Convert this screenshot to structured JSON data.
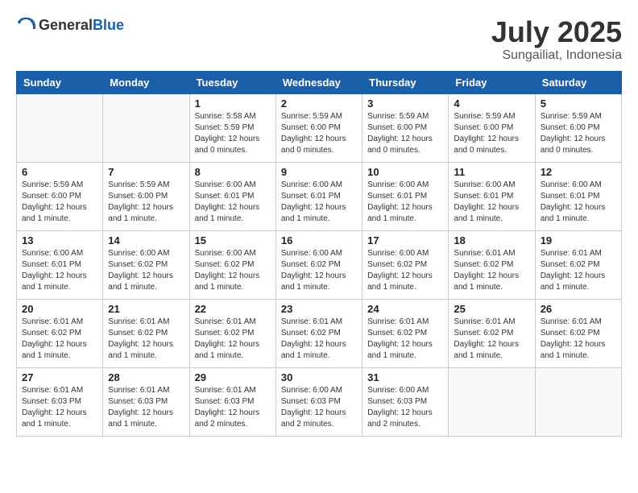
{
  "header": {
    "logo_general": "General",
    "logo_blue": "Blue",
    "month": "July 2025",
    "location": "Sungailiat, Indonesia"
  },
  "weekdays": [
    "Sunday",
    "Monday",
    "Tuesday",
    "Wednesday",
    "Thursday",
    "Friday",
    "Saturday"
  ],
  "weeks": [
    [
      {
        "day": "",
        "info": ""
      },
      {
        "day": "",
        "info": ""
      },
      {
        "day": "1",
        "info": "Sunrise: 5:58 AM\nSunset: 5:59 PM\nDaylight: 12 hours and 0 minutes."
      },
      {
        "day": "2",
        "info": "Sunrise: 5:59 AM\nSunset: 6:00 PM\nDaylight: 12 hours and 0 minutes."
      },
      {
        "day": "3",
        "info": "Sunrise: 5:59 AM\nSunset: 6:00 PM\nDaylight: 12 hours and 0 minutes."
      },
      {
        "day": "4",
        "info": "Sunrise: 5:59 AM\nSunset: 6:00 PM\nDaylight: 12 hours and 0 minutes."
      },
      {
        "day": "5",
        "info": "Sunrise: 5:59 AM\nSunset: 6:00 PM\nDaylight: 12 hours and 0 minutes."
      }
    ],
    [
      {
        "day": "6",
        "info": "Sunrise: 5:59 AM\nSunset: 6:00 PM\nDaylight: 12 hours and 1 minute."
      },
      {
        "day": "7",
        "info": "Sunrise: 5:59 AM\nSunset: 6:00 PM\nDaylight: 12 hours and 1 minute."
      },
      {
        "day": "8",
        "info": "Sunrise: 6:00 AM\nSunset: 6:01 PM\nDaylight: 12 hours and 1 minute."
      },
      {
        "day": "9",
        "info": "Sunrise: 6:00 AM\nSunset: 6:01 PM\nDaylight: 12 hours and 1 minute."
      },
      {
        "day": "10",
        "info": "Sunrise: 6:00 AM\nSunset: 6:01 PM\nDaylight: 12 hours and 1 minute."
      },
      {
        "day": "11",
        "info": "Sunrise: 6:00 AM\nSunset: 6:01 PM\nDaylight: 12 hours and 1 minute."
      },
      {
        "day": "12",
        "info": "Sunrise: 6:00 AM\nSunset: 6:01 PM\nDaylight: 12 hours and 1 minute."
      }
    ],
    [
      {
        "day": "13",
        "info": "Sunrise: 6:00 AM\nSunset: 6:01 PM\nDaylight: 12 hours and 1 minute."
      },
      {
        "day": "14",
        "info": "Sunrise: 6:00 AM\nSunset: 6:02 PM\nDaylight: 12 hours and 1 minute."
      },
      {
        "day": "15",
        "info": "Sunrise: 6:00 AM\nSunset: 6:02 PM\nDaylight: 12 hours and 1 minute."
      },
      {
        "day": "16",
        "info": "Sunrise: 6:00 AM\nSunset: 6:02 PM\nDaylight: 12 hours and 1 minute."
      },
      {
        "day": "17",
        "info": "Sunrise: 6:00 AM\nSunset: 6:02 PM\nDaylight: 12 hours and 1 minute."
      },
      {
        "day": "18",
        "info": "Sunrise: 6:01 AM\nSunset: 6:02 PM\nDaylight: 12 hours and 1 minute."
      },
      {
        "day": "19",
        "info": "Sunrise: 6:01 AM\nSunset: 6:02 PM\nDaylight: 12 hours and 1 minute."
      }
    ],
    [
      {
        "day": "20",
        "info": "Sunrise: 6:01 AM\nSunset: 6:02 PM\nDaylight: 12 hours and 1 minute."
      },
      {
        "day": "21",
        "info": "Sunrise: 6:01 AM\nSunset: 6:02 PM\nDaylight: 12 hours and 1 minute."
      },
      {
        "day": "22",
        "info": "Sunrise: 6:01 AM\nSunset: 6:02 PM\nDaylight: 12 hours and 1 minute."
      },
      {
        "day": "23",
        "info": "Sunrise: 6:01 AM\nSunset: 6:02 PM\nDaylight: 12 hours and 1 minute."
      },
      {
        "day": "24",
        "info": "Sunrise: 6:01 AM\nSunset: 6:02 PM\nDaylight: 12 hours and 1 minute."
      },
      {
        "day": "25",
        "info": "Sunrise: 6:01 AM\nSunset: 6:02 PM\nDaylight: 12 hours and 1 minute."
      },
      {
        "day": "26",
        "info": "Sunrise: 6:01 AM\nSunset: 6:02 PM\nDaylight: 12 hours and 1 minute."
      }
    ],
    [
      {
        "day": "27",
        "info": "Sunrise: 6:01 AM\nSunset: 6:03 PM\nDaylight: 12 hours and 1 minute."
      },
      {
        "day": "28",
        "info": "Sunrise: 6:01 AM\nSunset: 6:03 PM\nDaylight: 12 hours and 1 minute."
      },
      {
        "day": "29",
        "info": "Sunrise: 6:01 AM\nSunset: 6:03 PM\nDaylight: 12 hours and 2 minutes."
      },
      {
        "day": "30",
        "info": "Sunrise: 6:00 AM\nSunset: 6:03 PM\nDaylight: 12 hours and 2 minutes."
      },
      {
        "day": "31",
        "info": "Sunrise: 6:00 AM\nSunset: 6:03 PM\nDaylight: 12 hours and 2 minutes."
      },
      {
        "day": "",
        "info": ""
      },
      {
        "day": "",
        "info": ""
      }
    ]
  ]
}
